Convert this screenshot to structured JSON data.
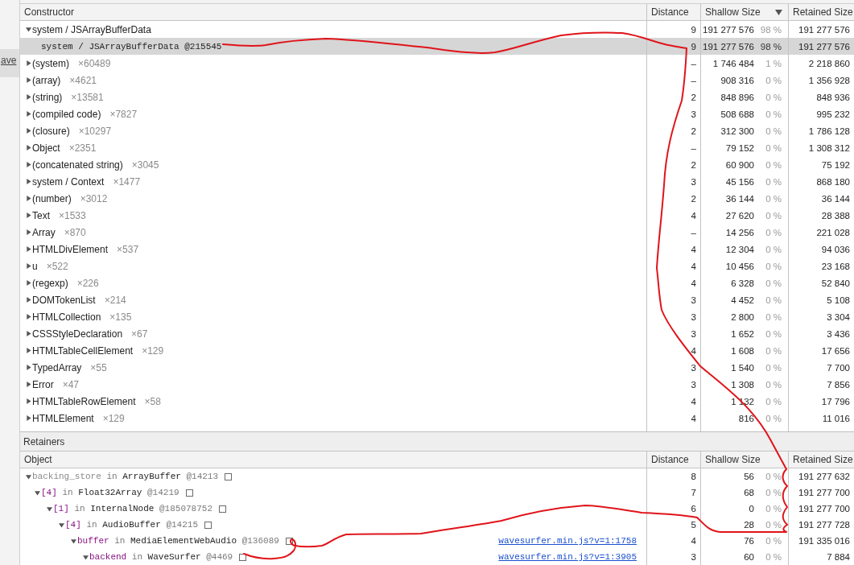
{
  "sidebar": {
    "link": "ave"
  },
  "summary_table": {
    "columns": [
      {
        "label": "Constructor",
        "sort_descending": false
      },
      {
        "label": "Distance",
        "sort_descending": false
      },
      {
        "label": "Shallow Size",
        "sort_descending": true
      },
      {
        "label": "Retained Size",
        "sort_descending": false
      }
    ],
    "rows": [
      {
        "kind": "group",
        "name": "system / JSArrayBufferData",
        "distance": "9",
        "shallow": "191 277 576",
        "shallow_pct": "98 %",
        "retained": "191 277 576",
        "expanded": true,
        "selected": false,
        "children": [
          {
            "kind": "instance",
            "name": "system / JSArrayBufferData",
            "id": "@215545",
            "distance": "9",
            "shallow": "191 277 576",
            "shallow_pct": "98 %",
            "retained": "191 277 576",
            "selected": true
          }
        ]
      },
      {
        "kind": "group",
        "name": "(system)",
        "count": "×60489",
        "distance": "–",
        "shallow": "1 746 484",
        "shallow_pct": "1 %",
        "retained": "2 218 860",
        "expanded": false,
        "selected": false
      },
      {
        "kind": "group",
        "name": "(array)",
        "count": "×4621",
        "distance": "–",
        "shallow": "908 316",
        "shallow_pct": "0 %",
        "retained": "1 356 928",
        "expanded": false,
        "selected": false
      },
      {
        "kind": "group",
        "name": "(string)",
        "count": "×13581",
        "distance": "2",
        "shallow": "848 896",
        "shallow_pct": "0 %",
        "retained": "848 936",
        "expanded": false,
        "selected": false
      },
      {
        "kind": "group",
        "name": "(compiled code)",
        "count": "×7827",
        "distance": "3",
        "shallow": "508 688",
        "shallow_pct": "0 %",
        "retained": "995 232",
        "expanded": false,
        "selected": false
      },
      {
        "kind": "group",
        "name": "(closure)",
        "count": "×10297",
        "distance": "2",
        "shallow": "312 300",
        "shallow_pct": "0 %",
        "retained": "1 786 128",
        "expanded": false,
        "selected": false
      },
      {
        "kind": "group",
        "name": "Object",
        "count": "×2351",
        "distance": "–",
        "shallow": "79 152",
        "shallow_pct": "0 %",
        "retained": "1 308 312",
        "expanded": false,
        "selected": false
      },
      {
        "kind": "group",
        "name": "(concatenated string)",
        "count": "×3045",
        "distance": "2",
        "shallow": "60 900",
        "shallow_pct": "0 %",
        "retained": "75 192",
        "expanded": false,
        "selected": false
      },
      {
        "kind": "group",
        "name": "system / Context",
        "count": "×1477",
        "distance": "3",
        "shallow": "45 156",
        "shallow_pct": "0 %",
        "retained": "868 180",
        "expanded": false,
        "selected": false
      },
      {
        "kind": "group",
        "name": "(number)",
        "count": "×3012",
        "distance": "2",
        "shallow": "36 144",
        "shallow_pct": "0 %",
        "retained": "36 144",
        "expanded": false,
        "selected": false
      },
      {
        "kind": "group",
        "name": "Text",
        "count": "×1533",
        "distance": "4",
        "shallow": "27 620",
        "shallow_pct": "0 %",
        "retained": "28 388",
        "expanded": false,
        "selected": false
      },
      {
        "kind": "group",
        "name": "Array",
        "count": "×870",
        "distance": "–",
        "shallow": "14 256",
        "shallow_pct": "0 %",
        "retained": "221 028",
        "expanded": false,
        "selected": false
      },
      {
        "kind": "group",
        "name": "HTMLDivElement",
        "count": "×537",
        "distance": "4",
        "shallow": "12 304",
        "shallow_pct": "0 %",
        "retained": "94 036",
        "expanded": false,
        "selected": false
      },
      {
        "kind": "group",
        "name": "u",
        "count": "×522",
        "distance": "4",
        "shallow": "10 456",
        "shallow_pct": "0 %",
        "retained": "23 168",
        "expanded": false,
        "selected": false
      },
      {
        "kind": "group",
        "name": "(regexp)",
        "count": "×226",
        "distance": "4",
        "shallow": "6 328",
        "shallow_pct": "0 %",
        "retained": "52 840",
        "expanded": false,
        "selected": false
      },
      {
        "kind": "group",
        "name": "DOMTokenList",
        "count": "×214",
        "distance": "3",
        "shallow": "4 452",
        "shallow_pct": "0 %",
        "retained": "5 108",
        "expanded": false,
        "selected": false
      },
      {
        "kind": "group",
        "name": "HTMLCollection",
        "count": "×135",
        "distance": "3",
        "shallow": "2 800",
        "shallow_pct": "0 %",
        "retained": "3 304",
        "expanded": false,
        "selected": false
      },
      {
        "kind": "group",
        "name": "CSSStyleDeclaration",
        "count": "×67",
        "distance": "3",
        "shallow": "1 652",
        "shallow_pct": "0 %",
        "retained": "3 436",
        "expanded": false,
        "selected": false
      },
      {
        "kind": "group",
        "name": "HTMLTableCellElement",
        "count": "×129",
        "distance": "4",
        "shallow": "1 608",
        "shallow_pct": "0 %",
        "retained": "17 656",
        "expanded": false,
        "selected": false
      },
      {
        "kind": "group",
        "name": "TypedArray",
        "count": "×55",
        "distance": "3",
        "shallow": "1 540",
        "shallow_pct": "0 %",
        "retained": "7 700",
        "expanded": false,
        "selected": false
      },
      {
        "kind": "group",
        "name": "Error",
        "count": "×47",
        "distance": "3",
        "shallow": "1 308",
        "shallow_pct": "0 %",
        "retained": "7 856",
        "expanded": false,
        "selected": false
      },
      {
        "kind": "group",
        "name": "HTMLTableRowElement",
        "count": "×58",
        "distance": "4",
        "shallow": "1 132",
        "shallow_pct": "0 %",
        "retained": "17 796",
        "expanded": false,
        "selected": false
      },
      {
        "kind": "group",
        "name": "HTMLElement",
        "count": "×129",
        "distance": "4",
        "shallow": "816",
        "shallow_pct": "0 %",
        "retained": "11 016",
        "expanded": false,
        "selected": false
      }
    ]
  },
  "retainers": {
    "title": "Retainers",
    "columns": [
      {
        "label": "Object"
      },
      {
        "label": "Distance"
      },
      {
        "label": "Shallow Size"
      },
      {
        "label": "Retained Size"
      }
    ],
    "rows": [
      {
        "edge": "backing_store",
        "kind": "internal",
        "relation": "in",
        "object": "ArrayBuffer",
        "id": "@14213",
        "distance": "8",
        "shallow": "56",
        "shallow_pct": "0 %",
        "retained": "191 277 632",
        "expanded": true,
        "children": [
          {
            "edge": "[4]",
            "kind": "element",
            "relation": "in",
            "object": "Float32Array",
            "id": "@14219",
            "distance": "7",
            "shallow": "68",
            "shallow_pct": "0 %",
            "retained": "191 277 700",
            "expanded": true,
            "children": [
              {
                "edge": "[1]",
                "kind": "element",
                "relation": "in",
                "object": "InternalNode",
                "id": "@185078752",
                "distance": "6",
                "shallow": "0",
                "shallow_pct": "0 %",
                "retained": "191 277 700",
                "expanded": true,
                "children": [
                  {
                    "edge": "[4]",
                    "kind": "element",
                    "relation": "in",
                    "object": "AudioBuffer",
                    "id": "@14215",
                    "distance": "5",
                    "shallow": "28",
                    "shallow_pct": "0 %",
                    "retained": "191 277 728",
                    "expanded": true,
                    "children": [
                      {
                        "edge": "buffer",
                        "kind": "property",
                        "relation": "in",
                        "object": "MediaElementWebAudio",
                        "id": "@136089",
                        "link": "wavesurfer.min.js?v=1:1758",
                        "distance": "4",
                        "shallow": "76",
                        "shallow_pct": "0 %",
                        "retained": "191 335 016",
                        "expanded": true,
                        "children": [
                          {
                            "edge": "backend",
                            "kind": "property",
                            "relation": "in",
                            "object": "WaveSurfer",
                            "id": "@4469",
                            "link": "wavesurfer.min.js?v=1:3905",
                            "distance": "3",
                            "shallow": "60",
                            "shallow_pct": "0 %",
                            "retained": "7 884",
                            "expanded": true
                          }
                        ]
                      }
                    ]
                  }
                ]
              }
            ]
          }
        ]
      }
    ]
  }
}
